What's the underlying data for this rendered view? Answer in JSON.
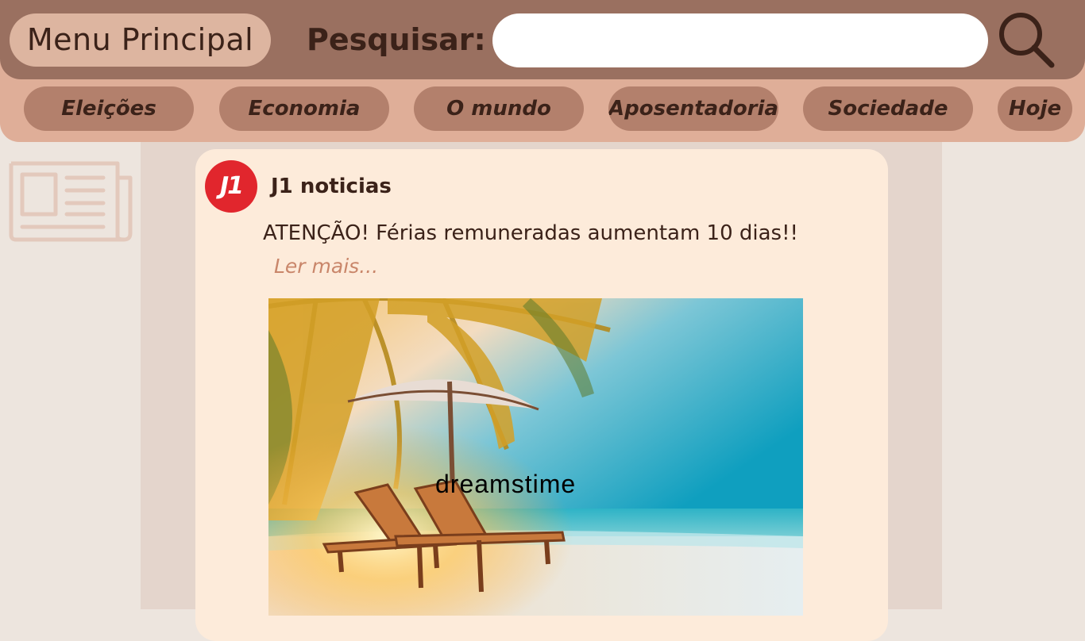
{
  "header": {
    "menu_label": "Menu Principal",
    "search_label": "Pesquisar:",
    "search_value": ""
  },
  "categories": [
    {
      "label": "Eleições"
    },
    {
      "label": "Economia"
    },
    {
      "label": "O mundo"
    },
    {
      "label": "Aposentadoria"
    },
    {
      "label": "Sociedade"
    },
    {
      "label": "Hoje"
    }
  ],
  "sidebar": {
    "icon": "newspaper-icon"
  },
  "post": {
    "avatar_text": "J1",
    "author": "J1 noticias",
    "headline": "ATENÇÃO! Férias remuneradas aumentam 10 dias!!",
    "read_more": "Ler mais...",
    "image_watermark": "dreamstime"
  },
  "colors": {
    "header_bg": "#9a7060",
    "category_bar_bg": "#dfae98",
    "category_pill_bg": "#b3806c",
    "card_bg": "#fdebda",
    "text_dark": "#3b2219",
    "link": "#c9866a",
    "avatar_red": "#e1262d"
  }
}
